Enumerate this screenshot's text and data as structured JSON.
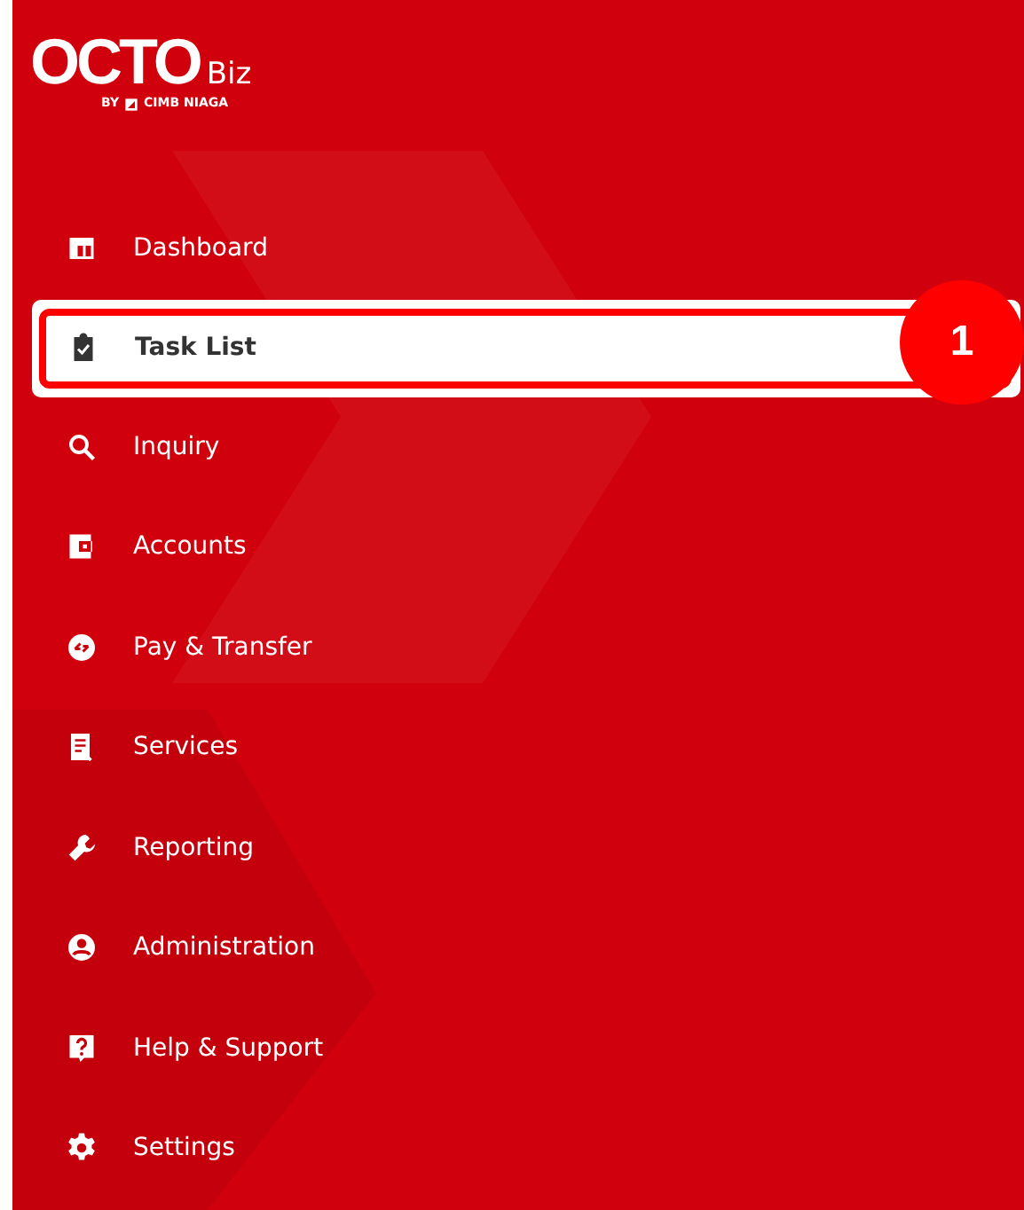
{
  "logo": {
    "wordmark": "OCTO",
    "suffix": "Biz",
    "byline": "BY",
    "bank": "CIMB NIAGA"
  },
  "menu": [
    {
      "label": "Dashboard",
      "selected": false
    },
    {
      "label": "Task List",
      "selected": true
    },
    {
      "label": "Inquiry",
      "selected": false
    },
    {
      "label": "Accounts",
      "selected": false
    },
    {
      "label": "Pay & Transfer",
      "selected": false
    },
    {
      "label": "Services",
      "selected": false
    },
    {
      "label": "Reporting",
      "selected": false
    },
    {
      "label": "Administration",
      "selected": false
    },
    {
      "label": "Help & Support",
      "selected": false
    },
    {
      "label": "Settings",
      "selected": false
    }
  ],
  "callout": {
    "label": "1"
  }
}
